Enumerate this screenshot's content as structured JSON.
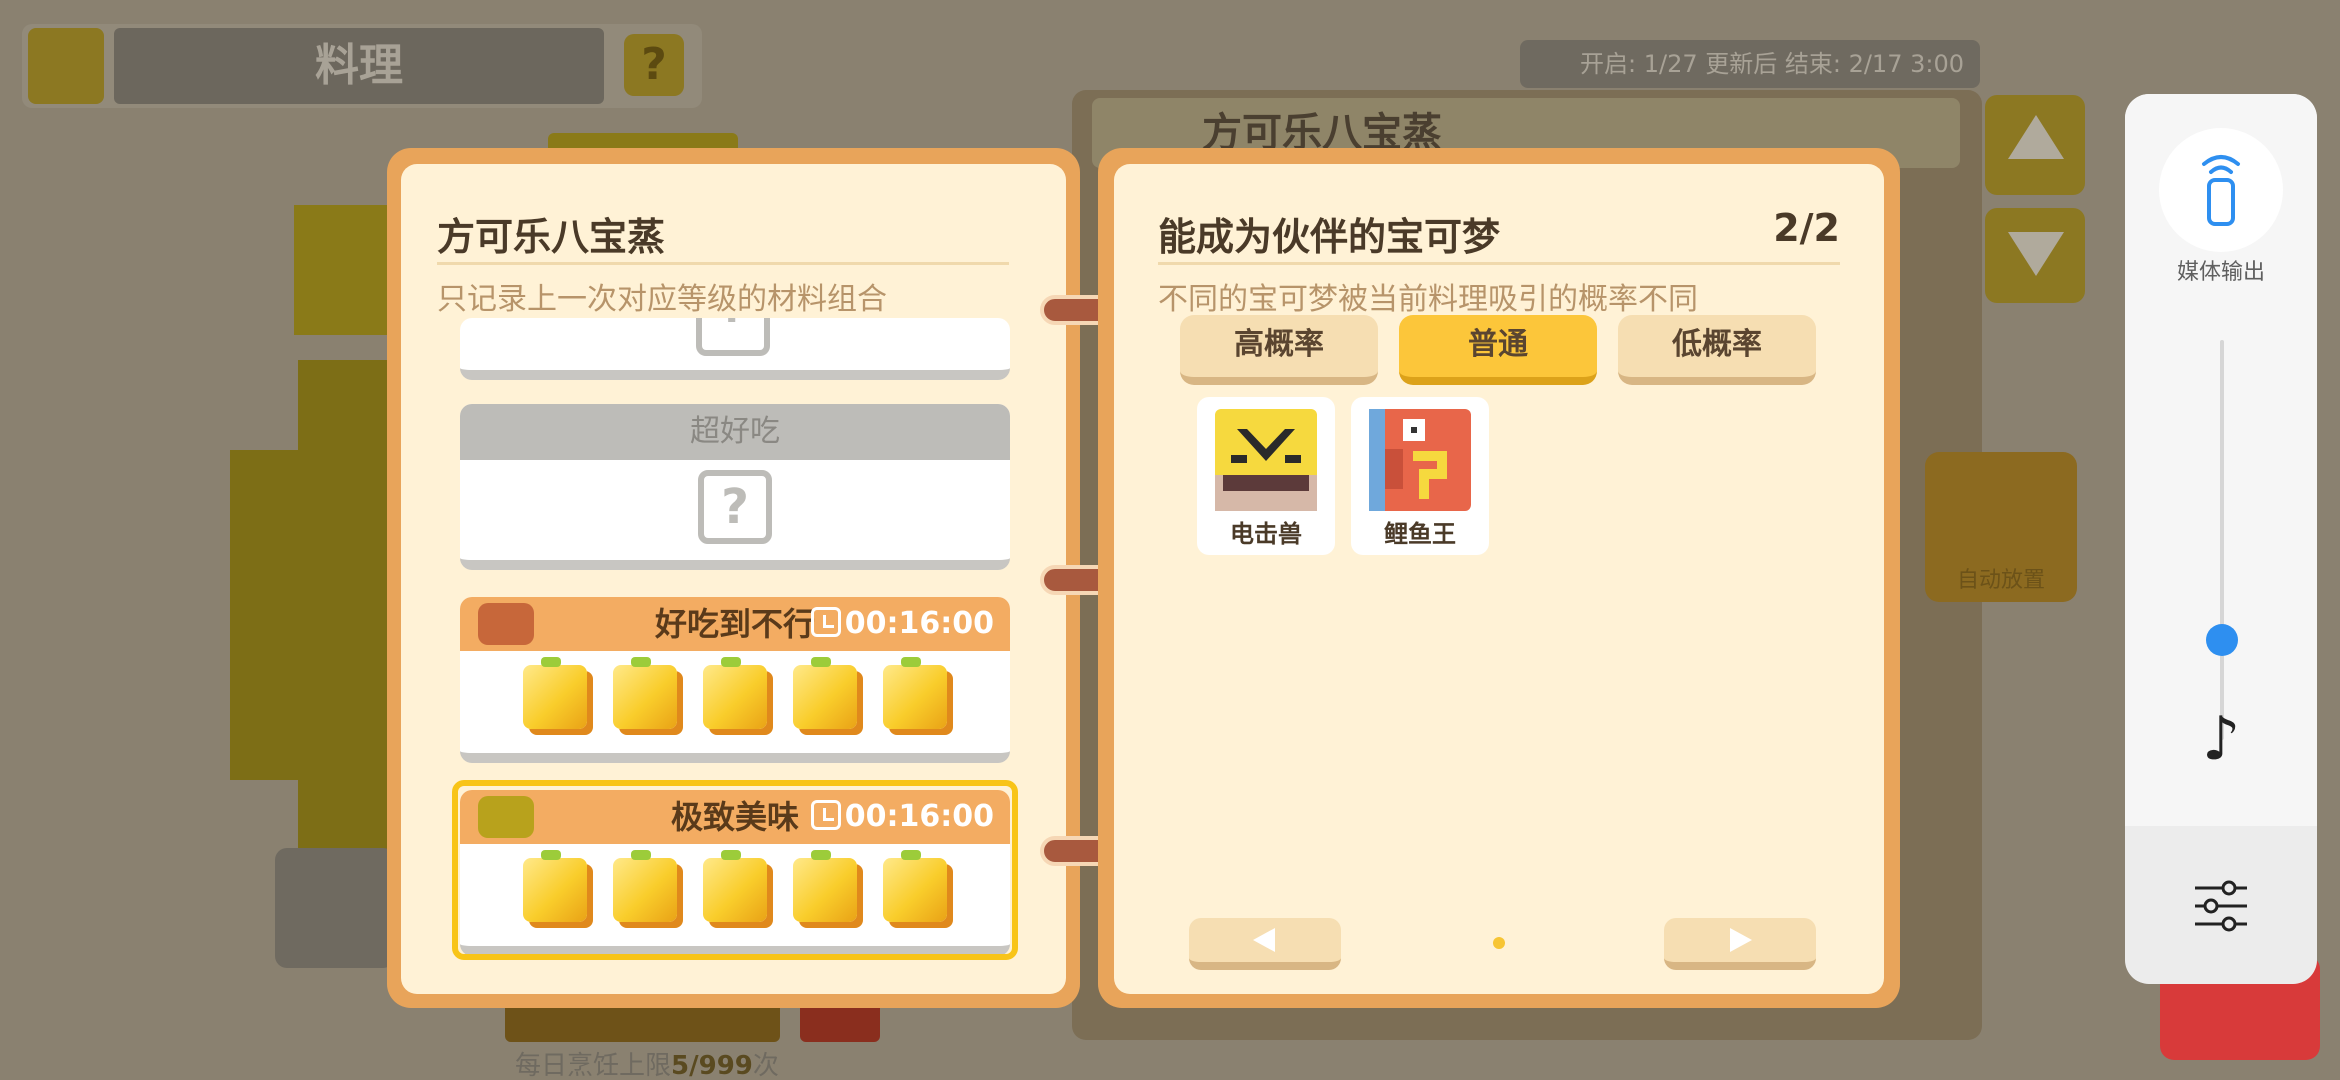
{
  "background": {
    "top_title": "料理",
    "top_help": "?",
    "event_text": "开启: 1/27 更新后 结束: 2/17 3:00",
    "panel_title": "方可乐八宝蒸",
    "auto_place": "自动放置",
    "daily_limit_prefix": "每日烹饪上限",
    "daily_limit_value": "5/999",
    "daily_limit_suffix": "次"
  },
  "left_page": {
    "title": "方可乐八宝蒸",
    "subtitle": "只记录上一次对应等级的材料组合",
    "cards": [
      {
        "grade": "超好吃",
        "unknown": "?"
      },
      {
        "grade": "好吃到不行",
        "time": "00:16:00",
        "pot_color": "#c7673a",
        "ingredients": 5
      },
      {
        "grade": "极致美味",
        "time": "00:16:00",
        "pot_color": "#b8a21c",
        "ingredients": 5,
        "selected": true
      }
    ],
    "top_partial_unknown": "?"
  },
  "right_page": {
    "title": "能成为伙伴的宝可梦",
    "page_indicator": "2/2",
    "subtitle": "不同的宝可梦被当前料理吸引的概率不同",
    "tabs": [
      {
        "label": "高概率",
        "active": false
      },
      {
        "label": "普通",
        "active": true
      },
      {
        "label": "低概率",
        "active": false
      }
    ],
    "pokemon": [
      {
        "name": "电击兽",
        "icon": "electabuzz-icon"
      },
      {
        "name": "鲤鱼王",
        "icon": "magikarp-icon"
      }
    ]
  },
  "media_panel": {
    "output_label": "媒体输出",
    "volume_level": 0.3
  }
}
